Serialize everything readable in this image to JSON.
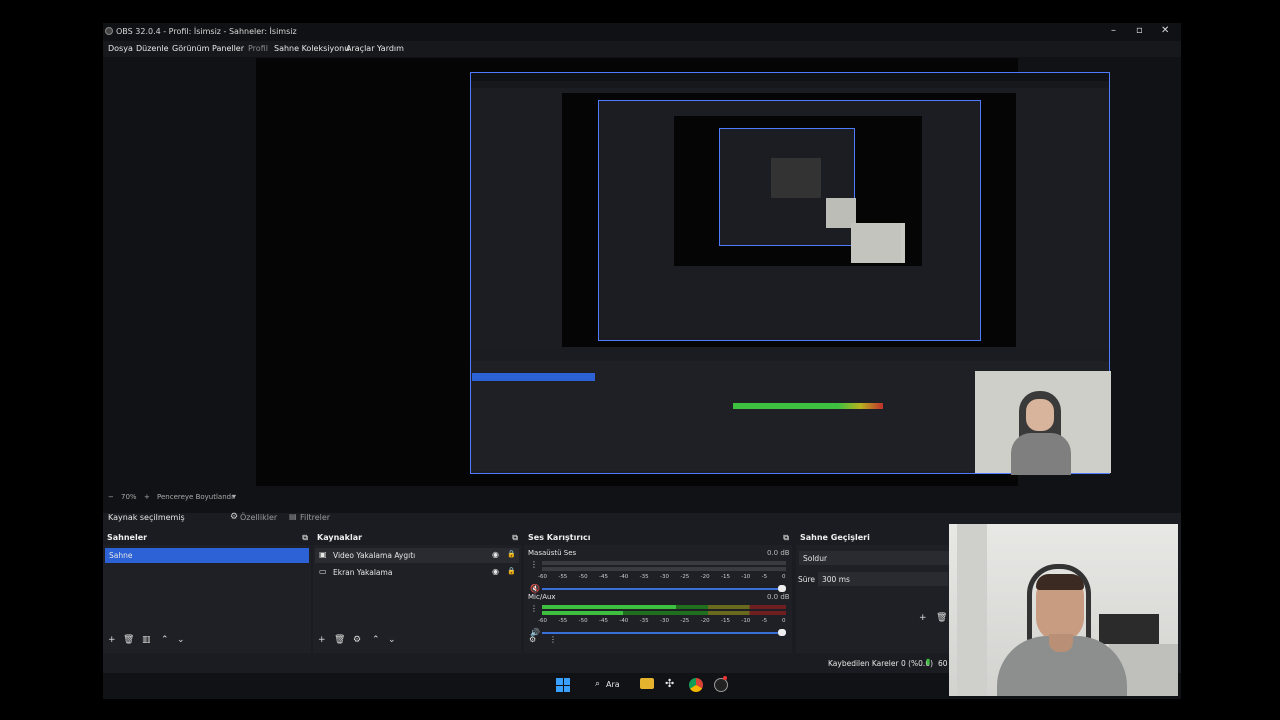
{
  "window": {
    "title": "OBS 32.0.4 - Profil: İsimsiz - Sahneler: İsimsiz",
    "minimize": "–",
    "maximize": "▫",
    "close": "✕"
  },
  "menu": [
    "Dosya",
    "Düzenle",
    "Görünüm",
    "Paneller",
    "Profil",
    "Sahne Koleksiyonu",
    "Araçlar",
    "Yardım"
  ],
  "zoom": {
    "minus": "−",
    "value": "70%",
    "plus": "+",
    "fit_label": "Pencereye Boyutlandır",
    "dropdown": "▾"
  },
  "source_toolbar": {
    "no_source": "Kaynak seçilmemiş",
    "properties": "Özellikler",
    "filters": "Filtreler"
  },
  "scenes": {
    "title": "Sahneler",
    "items": [
      "Sahne"
    ]
  },
  "sources": {
    "title": "Kaynaklar",
    "items": [
      {
        "label": "Video Yakalama Aygıtı"
      },
      {
        "label": "Ekran Yakalama"
      }
    ]
  },
  "mixer": {
    "title": "Ses Karıştırıcı",
    "channels": [
      {
        "name": "Masaüstü Ses",
        "db": "0.0 dB",
        "level": 0
      },
      {
        "name": "Mic/Aux",
        "db": "0.0 dB",
        "level": 0.55
      }
    ],
    "scale": [
      "-60",
      "-55",
      "-50",
      "-45",
      "-40",
      "-35",
      "-30",
      "-25",
      "-20",
      "-15",
      "-10",
      "-5",
      "0"
    ]
  },
  "transitions": {
    "title": "Sahne Geçişleri",
    "selected": "Soldur",
    "duration_label": "Süre",
    "duration_value": "300 ms"
  },
  "status": {
    "dropped_frames": "Kaybedilen Kareler 0 (%0.0)",
    "fps_partial": "60"
  },
  "taskbar": {
    "search_label": "Ara"
  },
  "colors": {
    "selection": "#2c62d6",
    "preview_border": "#4f7cff",
    "meter_green": "#3fbf3f",
    "meter_yellow": "#b9b31f",
    "meter_red": "#c0302c"
  }
}
